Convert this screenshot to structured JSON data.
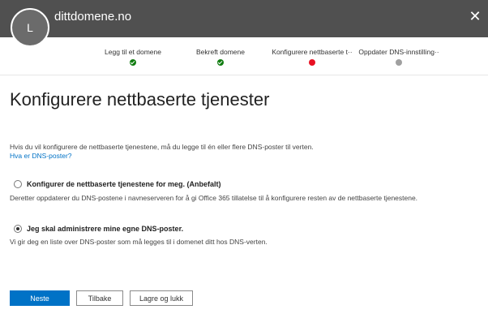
{
  "header": {
    "avatar_initial": "L",
    "domain": "dittdomene.no",
    "close_glyph": "✕"
  },
  "steps": [
    {
      "label": "Legg til et domene",
      "status": "done"
    },
    {
      "label": "Bekreft domene",
      "status": "done"
    },
    {
      "label": "Konfigurere nettbaserte t··",
      "status": "current"
    },
    {
      "label": "Oppdater DNS-innstilling··",
      "status": "pending"
    }
  ],
  "main": {
    "title": "Konfigurere nettbaserte tjenester",
    "intro": "Hvis du vil konfigurere de nettbaserte tjenestene, må du legge til én eller flere DNS-poster til verten.",
    "dns_link": "Hva er DNS-poster?",
    "options": [
      {
        "label": "Konfigurer de nettbaserte tjenestene for meg. (Anbefalt)",
        "description": "Deretter oppdaterer du DNS-postene i navneserveren for å gi Office 365 tillatelse til å konfigurere resten av de nettbaserte tjenestene.",
        "selected": false
      },
      {
        "label": "Jeg skal administrere mine egne DNS-poster.",
        "description": "Vi gir deg en liste over DNS-poster som må legges til i domenet ditt hos DNS-verten.",
        "selected": true
      }
    ]
  },
  "footer": {
    "next_label": "Neste",
    "back_label": "Tilbake",
    "save_label": "Lagre og lukk"
  },
  "colors": {
    "header_bg": "#505050",
    "accent": "#0072c6",
    "step_done": "#107c10",
    "step_current": "#e81123",
    "step_pending": "#a0a0a0"
  }
}
